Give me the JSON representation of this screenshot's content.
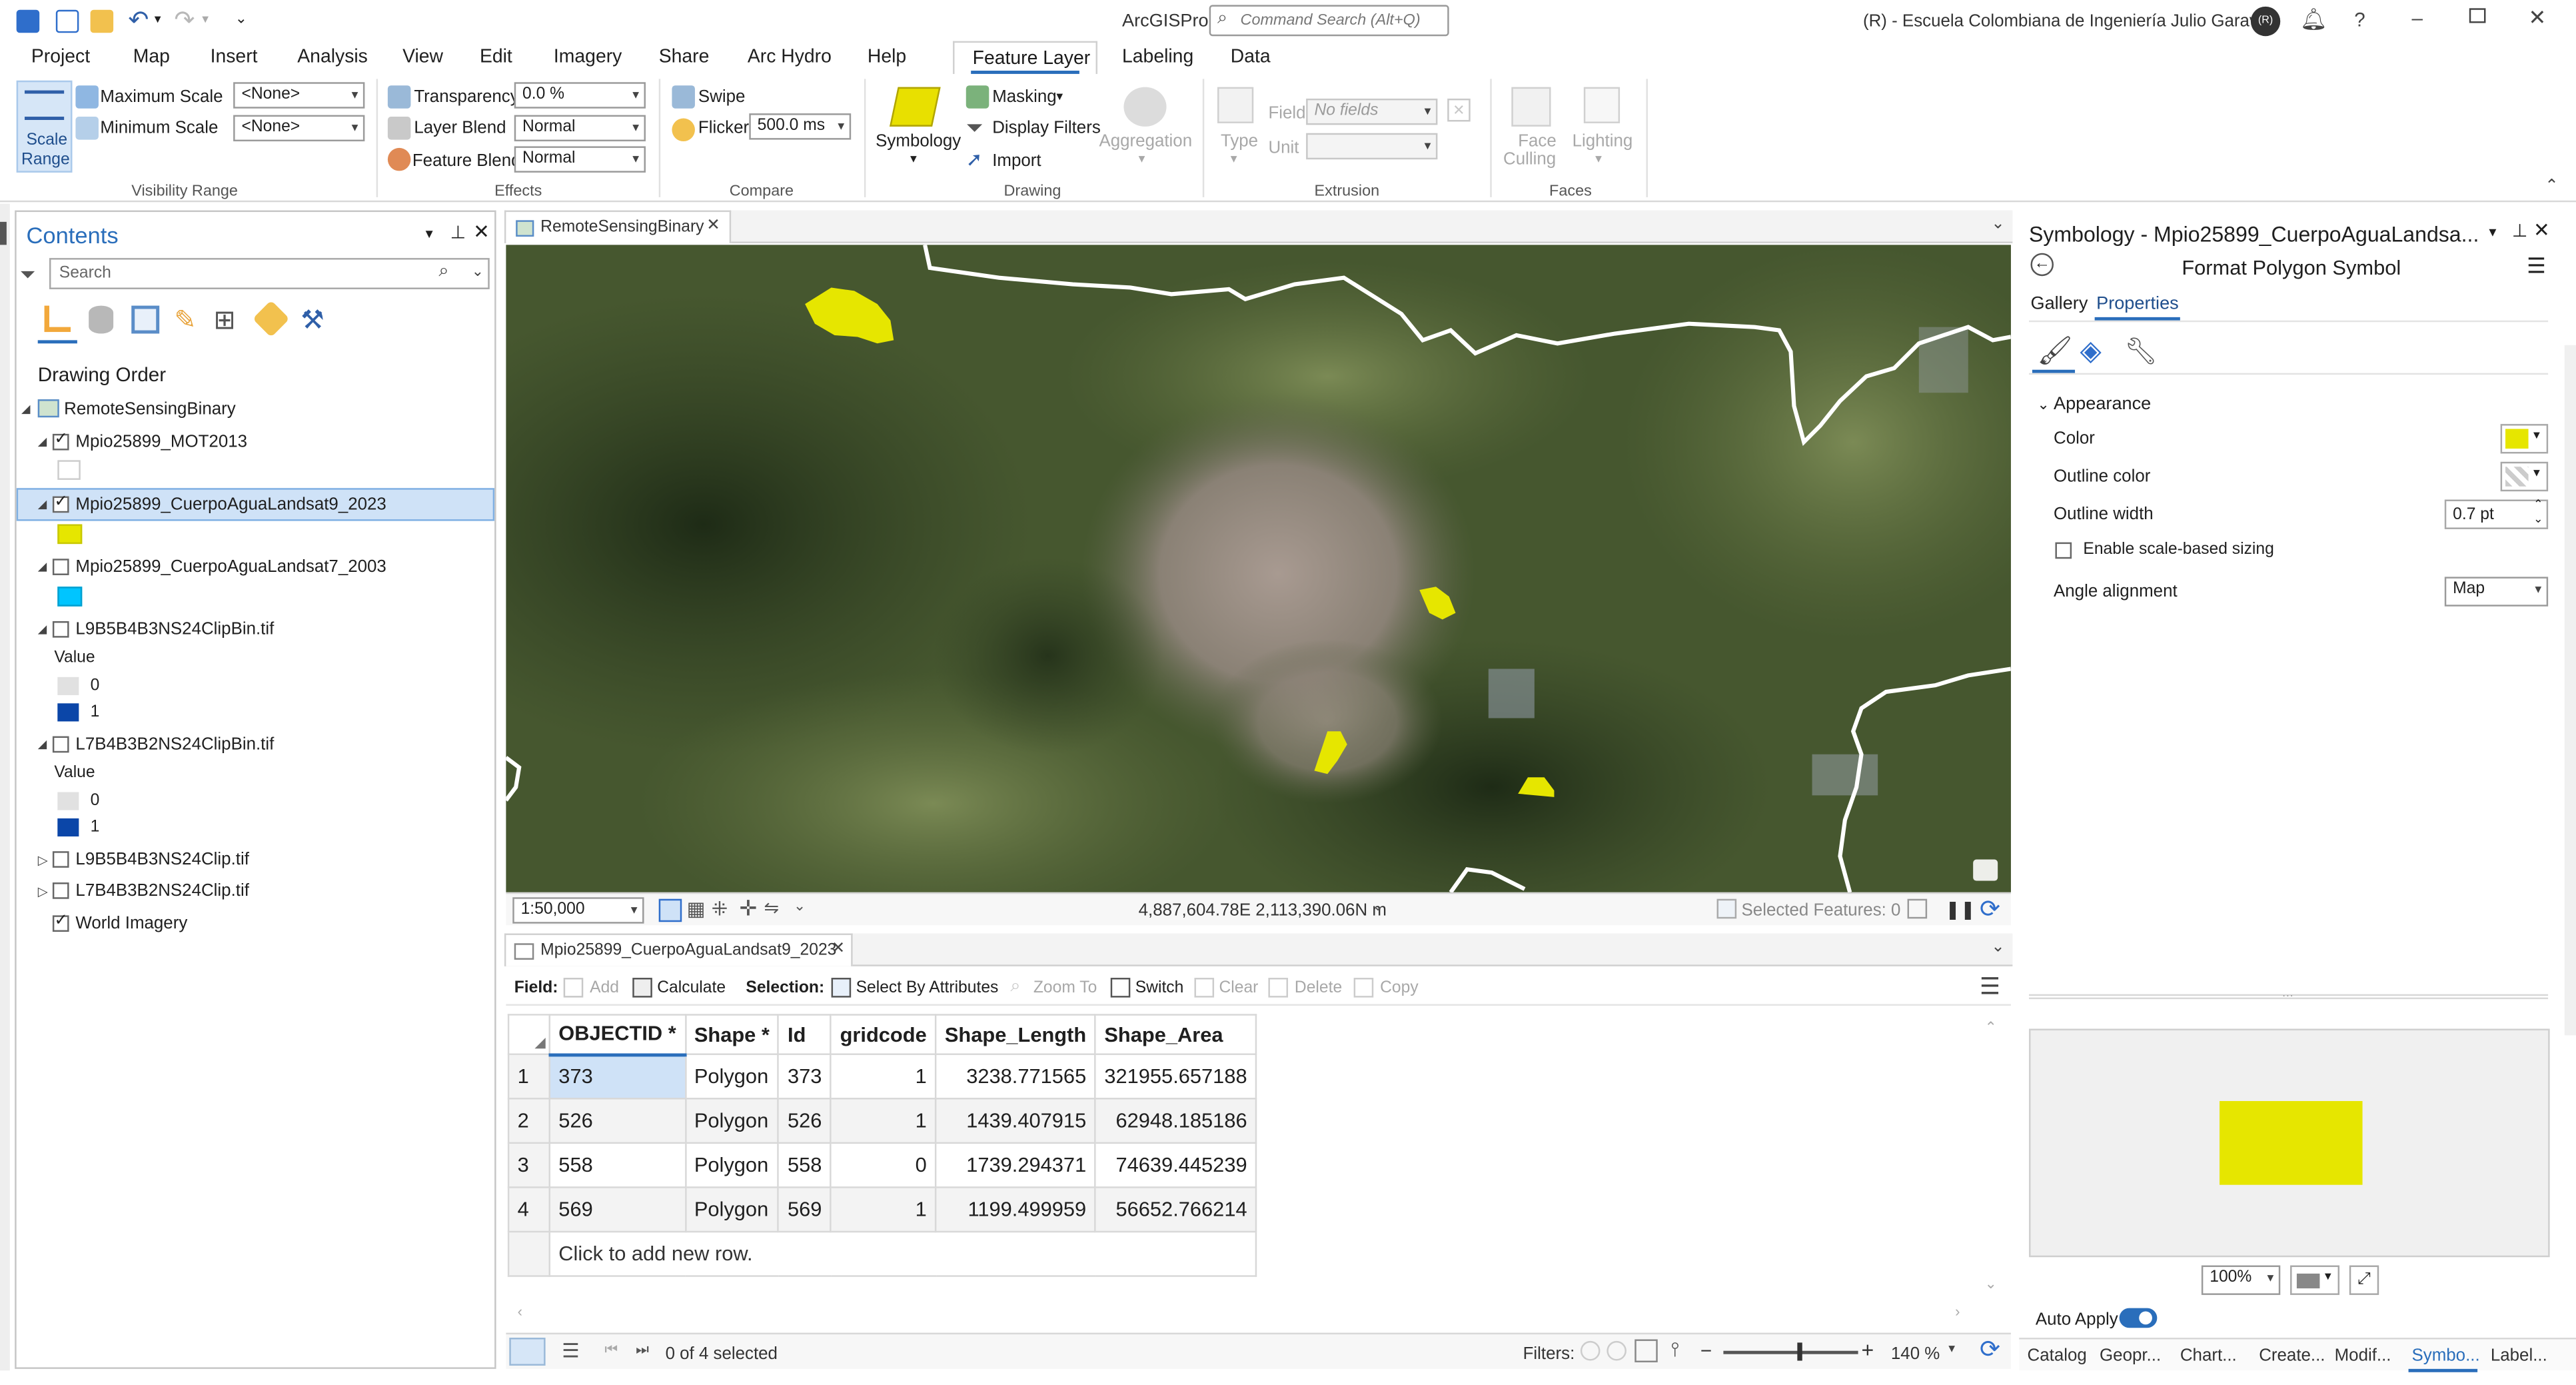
{
  "titlebar": {
    "app_name": "ArcGISPro",
    "search_placeholder": "Command Search (Alt+Q)",
    "org": "(R) - Escuela Colombiana de Ingeniería Julio Garavito",
    "avatar_initials": "(R)"
  },
  "tabs": [
    "Project",
    "Map",
    "Insert",
    "Analysis",
    "View",
    "Edit",
    "Imagery",
    "Share",
    "Arc Hydro",
    "Help",
    "Feature Layer",
    "Labeling",
    "Data"
  ],
  "active_tab": "Feature Layer",
  "ribbon": {
    "scale_range_line1": "Scale",
    "scale_range_line2": "Range",
    "max_scale_label": "Maximum Scale",
    "min_scale_label": "Minimum Scale",
    "max_scale_value": "<None>",
    "min_scale_value": "<None>",
    "visibility_group": "Visibility Range",
    "transparency_label": "Transparency",
    "transparency_value": "0.0 %",
    "layer_blend_label": "Layer Blend",
    "layer_blend_value": "Normal",
    "feature_blend_label": "Feature Blend",
    "feature_blend_value": "Normal",
    "effects_group": "Effects",
    "swipe_label": "Swipe",
    "flicker_label": "Flicker",
    "flicker_value": "500.0  ms",
    "compare_group": "Compare",
    "symbology_label": "Symbology",
    "masking_label": "Masking",
    "display_filters_label": "Display Filters",
    "import_label": "Import",
    "aggregation_label": "Aggregation",
    "drawing_group": "Drawing",
    "type_label": "Type",
    "field_label": "Field",
    "field_value": "No fields",
    "unit_label": "Unit",
    "extrusion_group": "Extrusion",
    "face_culling_line1": "Face",
    "face_culling_line2": "Culling",
    "lighting_label": "Lighting",
    "faces_group": "Faces"
  },
  "contents": {
    "title": "Contents",
    "search_placeholder": "Search",
    "drawing_order": "Drawing Order",
    "map_name": "RemoteSensingBinary",
    "layers": [
      {
        "name": "Mpio25899_MOT2013",
        "checked": true
      },
      {
        "name": "Mpio25899_CuerpoAguaLandsat9_2023",
        "checked": true
      },
      {
        "name": "Mpio25899_CuerpoAguaLandsat7_2003",
        "checked": false
      },
      {
        "name": "L9B5B4B3NS24ClipBin.tif",
        "checked": false
      },
      {
        "name": "L7B4B3B2NS24ClipBin.tif",
        "checked": false
      },
      {
        "name": "L9B5B4B3NS24Clip.tif",
        "checked": false
      },
      {
        "name": "L7B4B3B2NS24Clip.tif",
        "checked": false
      },
      {
        "name": "World Imagery",
        "checked": true
      }
    ],
    "value_label": "Value",
    "legend_0": "0",
    "legend_1": "1",
    "colors": {
      "yellow": "#e6e600",
      "cyan": "#00c5ff",
      "light": "#e1e1e1",
      "blue": "#0b46a8"
    }
  },
  "map": {
    "tab_title": "RemoteSensingBinary",
    "scale": "1:50,000",
    "coordinates": "4,887,604.78E 2,113,390.06N m",
    "selected_features": "Selected Features: 0"
  },
  "attribute_table": {
    "tab_title": "Mpio25899_CuerpoAguaLandsat9_2023",
    "field_label": "Field:",
    "add_label": "Add",
    "calculate_label": "Calculate",
    "selection_label": "Selection:",
    "select_by_attributes_label": "Select By Attributes",
    "zoom_to_label": "Zoom To",
    "switch_label": "Switch",
    "clear_label": "Clear",
    "delete_label": "Delete",
    "copy_label": "Copy",
    "columns": [
      "OBJECTID *",
      "Shape *",
      "Id",
      "gridcode",
      "Shape_Length",
      "Shape_Area"
    ],
    "rows": [
      {
        "n": "1",
        "cells": [
          "373",
          "Polygon",
          "373",
          "1",
          "3238.771565",
          "321955.657188"
        ]
      },
      {
        "n": "2",
        "cells": [
          "526",
          "Polygon",
          "526",
          "1",
          "1439.407915",
          "62948.185186"
        ]
      },
      {
        "n": "3",
        "cells": [
          "558",
          "Polygon",
          "558",
          "0",
          "1739.294371",
          "74639.445239"
        ]
      },
      {
        "n": "4",
        "cells": [
          "569",
          "Polygon",
          "569",
          "1",
          "1199.499959",
          "56652.766214"
        ]
      }
    ],
    "add_row_text": "Click to add new row.",
    "selected_count": "0 of 4 selected",
    "filters_label": "Filters:",
    "zoom_level": "140 %"
  },
  "symbology": {
    "title": "Symbology - Mpio25899_CuerpoAguaLandsa...",
    "subtitle": "Format Polygon Symbol",
    "tab_gallery": "Gallery",
    "tab_properties": "Properties",
    "appearance": "Appearance",
    "color_label": "Color",
    "outline_color_label": "Outline color",
    "outline_width_label": "Outline width",
    "outline_width_value": "0.7 pt",
    "enable_scale_label": "Enable scale-based sizing",
    "angle_alignment_label": "Angle alignment",
    "angle_alignment_value": "Map",
    "preview_zoom": "100%",
    "auto_apply_label": "Auto Apply",
    "fill_color": "#e6e600"
  },
  "bottom_tabs": [
    "Catalog",
    "Geopr...",
    "Chart...",
    "Create...",
    "Modif...",
    "Symbo...",
    "Label..."
  ]
}
